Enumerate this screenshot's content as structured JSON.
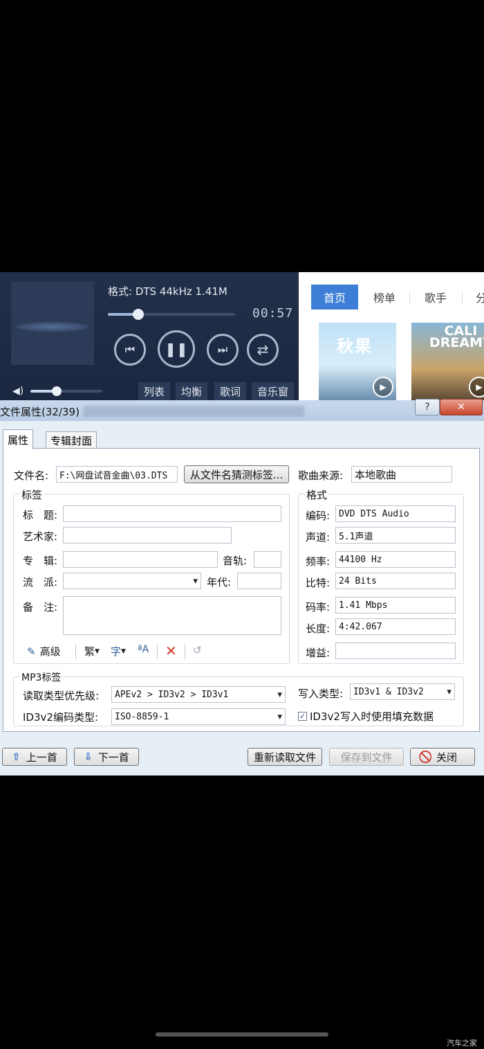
{
  "player": {
    "format": "格式: DTS 44kHz 1.41M",
    "progress_fraction": 0.24,
    "time": "00:57",
    "volume_fraction": 0.37,
    "tabs": [
      "列表",
      "均衡",
      "歌词",
      "音乐窗"
    ],
    "icons": {
      "prev": "previous-track-icon",
      "play": "pause-icon",
      "next": "next-track-icon",
      "mode": "shuffle-icon",
      "volume": "speaker-icon"
    }
  },
  "browse": {
    "nav": [
      "首页",
      "榜单",
      "歌手",
      "分"
    ],
    "active_color": "#3d7fd6",
    "covers": [
      {
        "title": "秋果"
      },
      {
        "title": "CALI DREAMY"
      }
    ]
  },
  "dialog": {
    "title": "文件属性(32/39)",
    "help": "?",
    "close_x": "✕",
    "tabs": [
      "属性",
      "专辑封面"
    ],
    "filename": {
      "label": "文件名:",
      "value": "F:\\网盘试音金曲\\03.DTS",
      "guess_button": "从文件名猜测标签..."
    },
    "source": {
      "label": "歌曲来源:",
      "value": "本地歌曲"
    },
    "tags": {
      "group": "标签",
      "title_label": "标　题:",
      "title": "",
      "artist_label": "艺术家:",
      "artist": "",
      "album_label": "专　辑:",
      "album": "",
      "track_label": "音轨:",
      "track": "",
      "genre_label": "流　派:",
      "genre": "",
      "year_label": "年代:",
      "year": "",
      "comment_label": "备　注:",
      "comment": ""
    },
    "toolbar": {
      "advanced": "高级",
      "traditional": "繁"
    },
    "format": {
      "group": "格式",
      "codec_label": "编码:",
      "codec": "DVD DTS Audio",
      "channels_label": "声道:",
      "channels": "5.1声道",
      "frequency_label": "频率:",
      "frequency": "44100 Hz",
      "bits_label": "比特:",
      "bits": "24 Bits",
      "bitrate_label": "码率:",
      "bitrate": "1.41 Mbps",
      "length_label": "长度:",
      "length": "4:42.067",
      "gain_label": "增益:",
      "gain": ""
    },
    "mp3": {
      "group": "MP3标签",
      "read_priority_label": "读取类型优先级:",
      "read_priority": "APEv2 > ID3v2 > ID3v1",
      "write_type_label": "写入类型:",
      "write_type": "ID3v1 & ID3v2",
      "encoding_label": "ID3v2编码类型:",
      "encoding": "ISO-8859-1",
      "padding_label": "ID3v2写入时使用填充数据",
      "padding_checked": true
    },
    "buttons": {
      "prev": "上一首",
      "next": "下一首",
      "reload": "重新读取文件",
      "save": "保存到文件",
      "close": "关闭"
    }
  },
  "watermark": "汽车之家"
}
